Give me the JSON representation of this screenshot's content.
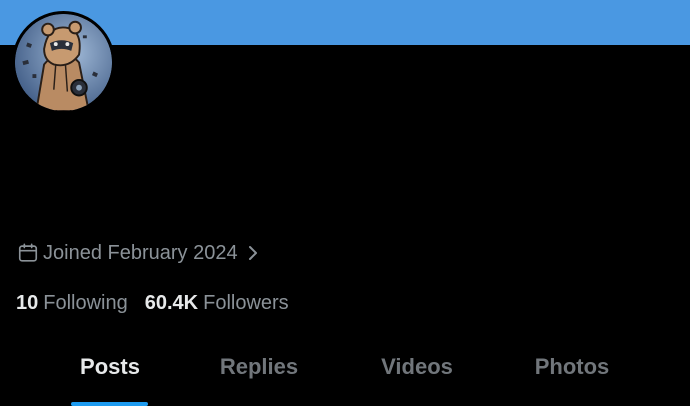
{
  "colors": {
    "banner": "#4a98e2",
    "accent": "#1d9bf0",
    "background": "#000000",
    "primary_text": "#e7e9ea",
    "secondary_text": "#71767b"
  },
  "profile": {
    "joined_text": "Joined February 2024",
    "following_count": "10",
    "following_label": "Following",
    "followers_count": "60.4K",
    "followers_label": "Followers"
  },
  "icons": {
    "calendar": "calendar-icon",
    "chevron": "chevron-right-icon"
  },
  "tabs": [
    {
      "label": "Posts",
      "active": true
    },
    {
      "label": "Replies",
      "active": false
    },
    {
      "label": "Videos",
      "active": false
    },
    {
      "label": "Photos",
      "active": false
    }
  ]
}
